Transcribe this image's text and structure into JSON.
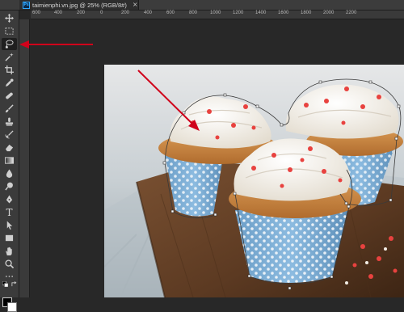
{
  "document_tab": {
    "badge": "Ps",
    "title": "taimienphi.vn.jpg @ 25% (RGB/8#)",
    "close": "×"
  },
  "ruler_labels": [
    "600",
    "400",
    "200",
    "0",
    "200",
    "400",
    "600",
    "800",
    "1000",
    "1200",
    "1400",
    "1600",
    "1800",
    "2000",
    "2200"
  ],
  "tools": [
    {
      "name": "move-tool",
      "icon": "move-icon"
    },
    {
      "name": "rectangular-marquee-tool",
      "icon": "marquee-icon"
    },
    {
      "name": "magnetic-lasso-tool",
      "icon": "magnetic-lasso-icon",
      "active": true
    },
    {
      "name": "magic-wand-tool",
      "icon": "magic-wand-icon"
    },
    {
      "name": "crop-tool",
      "icon": "crop-icon"
    },
    {
      "name": "eyedropper-tool",
      "icon": "eyedropper-icon"
    },
    {
      "name": "spot-healing-brush-tool",
      "icon": "bandage-icon"
    },
    {
      "name": "brush-tool",
      "icon": "brush-icon"
    },
    {
      "name": "clone-stamp-tool",
      "icon": "stamp-icon"
    },
    {
      "name": "history-brush-tool",
      "icon": "history-brush-icon"
    },
    {
      "name": "eraser-tool",
      "icon": "eraser-icon"
    },
    {
      "name": "gradient-tool",
      "icon": "gradient-icon"
    },
    {
      "name": "blur-tool",
      "icon": "drop-icon"
    },
    {
      "name": "dodge-tool",
      "icon": "dodge-icon"
    },
    {
      "name": "pen-tool",
      "icon": "pen-icon"
    },
    {
      "name": "type-tool",
      "icon": "type-icon",
      "glyph": "T"
    },
    {
      "name": "path-selection-tool",
      "icon": "arrow-icon"
    },
    {
      "name": "rectangle-tool",
      "icon": "rectangle-icon"
    },
    {
      "name": "hand-tool",
      "icon": "hand-icon"
    },
    {
      "name": "zoom-tool",
      "icon": "zoom-icon"
    }
  ],
  "colors": {
    "foreground": "#000000",
    "background": "#ffffff",
    "annotation_arrow": "#d0021b",
    "selection_path": "#3a3a3a",
    "accent": "#31a8ff"
  }
}
